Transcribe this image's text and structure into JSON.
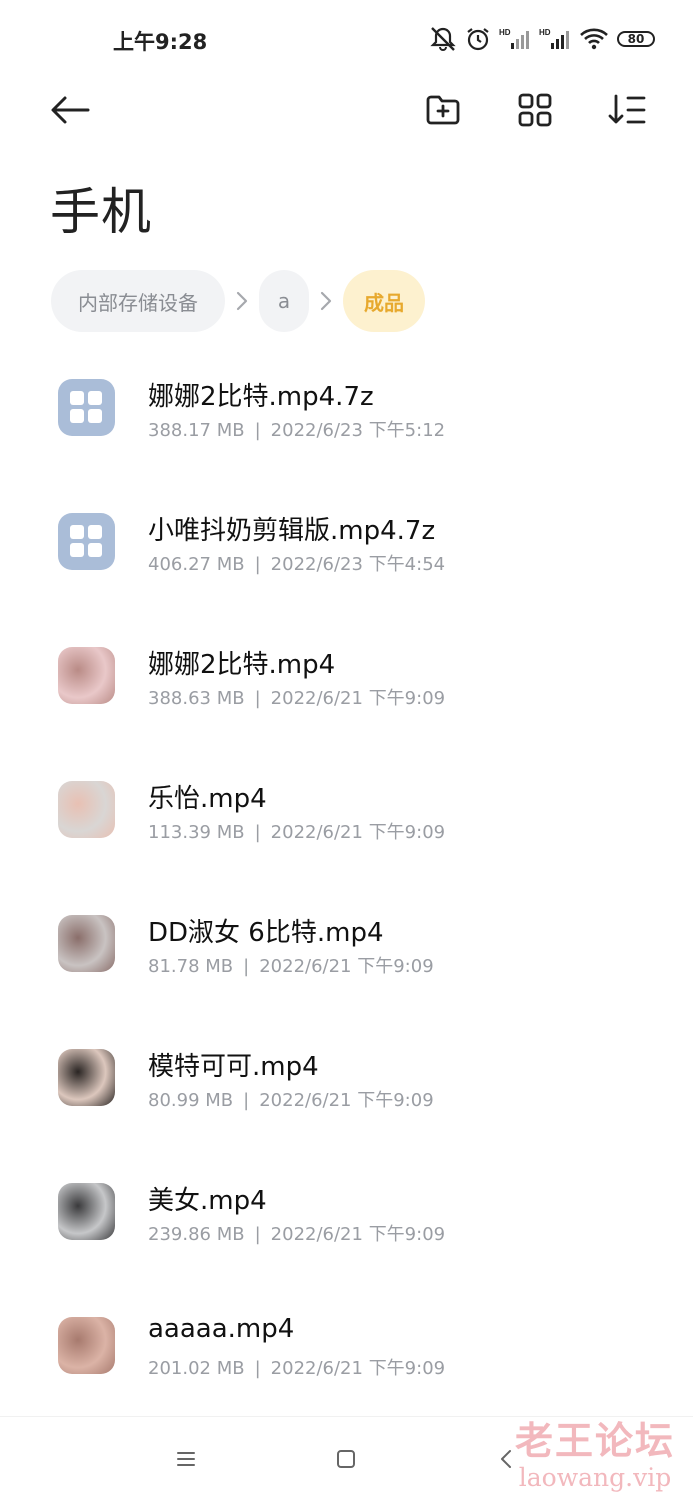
{
  "status_bar": {
    "time": "上午9:28",
    "battery": "80"
  },
  "page_title": "手机",
  "breadcrumb": [
    "内部存储设备",
    "a",
    "成品"
  ],
  "files": [
    {
      "name": "娜娜2比特.mp4.7z",
      "size": "388.17 MB",
      "date": "2022/6/23 下午5:12",
      "thumb": "archive",
      "thumb_colors": [
        "#aabdd8"
      ]
    },
    {
      "name": "小唯抖奶剪辑版.mp4.7z",
      "size": "406.27 MB",
      "date": "2022/6/23 下午4:54",
      "thumb": "archive",
      "thumb_colors": [
        "#aabdd8"
      ]
    },
    {
      "name": "娜娜2比特.mp4",
      "size": "388.63 MB",
      "date": "2022/6/21 下午9:09",
      "thumb": "video",
      "thumb_colors": [
        "#e9c8c9",
        "#b98b86"
      ]
    },
    {
      "name": "乐怡.mp4",
      "size": "113.39 MB",
      "date": "2022/6/21 下午9:09",
      "thumb": "video",
      "thumb_colors": [
        "#d9d6d4",
        "#e8c0b3"
      ]
    },
    {
      "name": "DD淑女 6比特.mp4",
      "size": "81.78 MB",
      "date": "2022/6/21 下午9:09",
      "thumb": "video",
      "thumb_colors": [
        "#c9c3c2",
        "#8a6e6a"
      ]
    },
    {
      "name": "模特可可.mp4",
      "size": "80.99 MB",
      "date": "2022/6/21 下午9:09",
      "thumb": "video",
      "thumb_colors": [
        "#dcc7bd",
        "#2a2523"
      ]
    },
    {
      "name": "美女.mp4",
      "size": "239.86 MB",
      "date": "2022/6/21 下午9:09",
      "thumb": "video",
      "thumb_colors": [
        "#c6c7c9",
        "#3a3a3c"
      ]
    },
    {
      "name": "aaaaa.mp4",
      "size": "201.02 MB",
      "date": "2022/6/21 下午9:09",
      "thumb": "video",
      "thumb_colors": [
        "#dbb3a6",
        "#a77a6e"
      ]
    }
  ],
  "watermark": {
    "main": "老王论坛",
    "sub": "laowang.vip"
  }
}
